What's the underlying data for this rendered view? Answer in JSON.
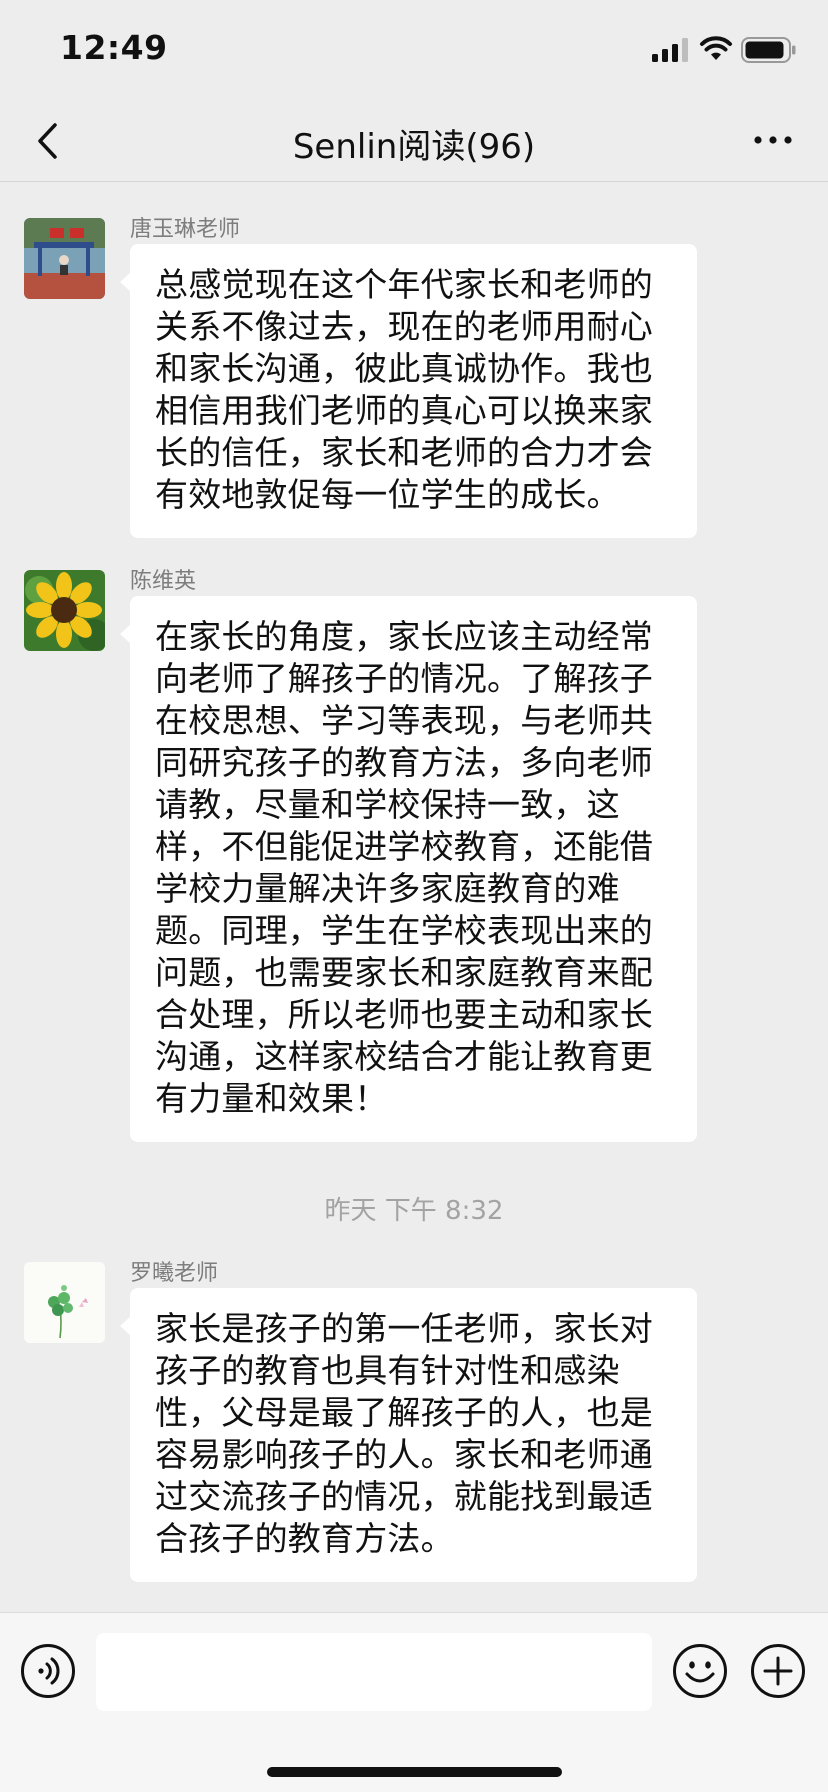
{
  "status_bar": {
    "time": "12:49"
  },
  "nav": {
    "title": "Senlin阅读(96)"
  },
  "messages": [
    {
      "sender": "唐玉琳老师",
      "avatar_icon": "playground-photo-avatar",
      "lines": [
        "总感觉现在这个年代家长和老师的",
        "关系不像过去，现在的老师用耐心",
        "和家长沟通，彼此真诚协作。我也",
        "相信用我们老师的真心可以换来家",
        "长的信任，家长和老师的合力才会",
        "有效地敦促每一位学生的成长。"
      ]
    },
    {
      "sender": "陈维英",
      "avatar_icon": "sunflower-avatar",
      "lines": [
        "在家长的角度，家长应该主动经常",
        "向老师了解孩子的情况。了解孩子",
        "在校思想、学习等表现，与老师共",
        "同研究孩子的教育方法，多向老师",
        "请教，尽量和学校保持一致，这",
        "样，不但能促进学校教育，还能借",
        "学校力量解决许多家庭教育的难",
        "题。同理，学生在学校表现出来的",
        "问题，也需要家长和家庭教育来配",
        "合处理，所以老师也要主动和家长",
        "沟通，这样家校结合才能让教育更",
        "有力量和效果！"
      ]
    },
    {
      "sender": "罗曦老师",
      "avatar_icon": "clover-avatar",
      "lines": [
        "家长是孩子的第一任老师，家长对",
        "孩子的教育也具有针对性和感染",
        "性，父母是最了解孩子的人，也是",
        "容易影响孩子的人。家长和老师通",
        "过交流孩子的情况，就能找到最适",
        "合孩子的教育方法。"
      ]
    }
  ],
  "timestamp": "昨天 下午 8:32",
  "input": {
    "placeholder": ""
  },
  "colors": {
    "background": "#ededed",
    "bubble": "#ffffff",
    "sender": "#7d7d7d",
    "timestamp": "#a3a3a3"
  }
}
